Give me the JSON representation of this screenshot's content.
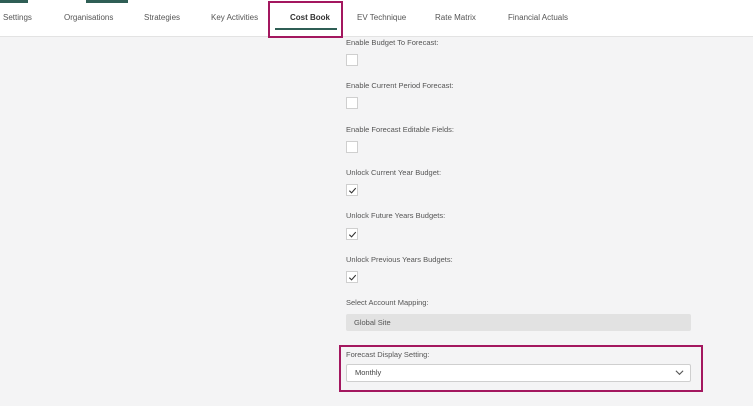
{
  "tabs": [
    {
      "label": "Settings"
    },
    {
      "label": "Organisations"
    },
    {
      "label": "Strategies"
    },
    {
      "label": "Key Activities"
    },
    {
      "label": "Cost Book"
    },
    {
      "label": "EV Technique"
    },
    {
      "label": "Rate Matrix"
    },
    {
      "label": "Financial Actuals"
    }
  ],
  "active_tab": "Cost Book",
  "fields": {
    "enable_budget_to_forecast": {
      "label": "Enable Budget To Forecast:",
      "checked": false
    },
    "enable_current_period_forecast": {
      "label": "Enable Current Period Forecast:",
      "checked": false
    },
    "enable_forecast_editable_fields": {
      "label": "Enable Forecast Editable Fields:",
      "checked": false
    },
    "unlock_current_year_budget": {
      "label": "Unlock Current Year Budget:",
      "checked": true
    },
    "unlock_future_years_budgets": {
      "label": "Unlock Future Years Budgets:",
      "checked": true
    },
    "unlock_previous_years_budgets": {
      "label": "Unlock Previous Years Budgets:",
      "checked": true
    },
    "select_account_mapping": {
      "label": "Select Account Mapping:",
      "value": "Global Site"
    },
    "forecast_display_setting": {
      "label": "Forecast Display Setting:",
      "value": "Monthly"
    }
  },
  "icons": {
    "checkbox_check": "check-icon",
    "select_chevron": "chevron-down-icon"
  },
  "colors": {
    "accent": "#2f5e55",
    "highlight": "#a3175f",
    "background": "#f4f4f5"
  }
}
